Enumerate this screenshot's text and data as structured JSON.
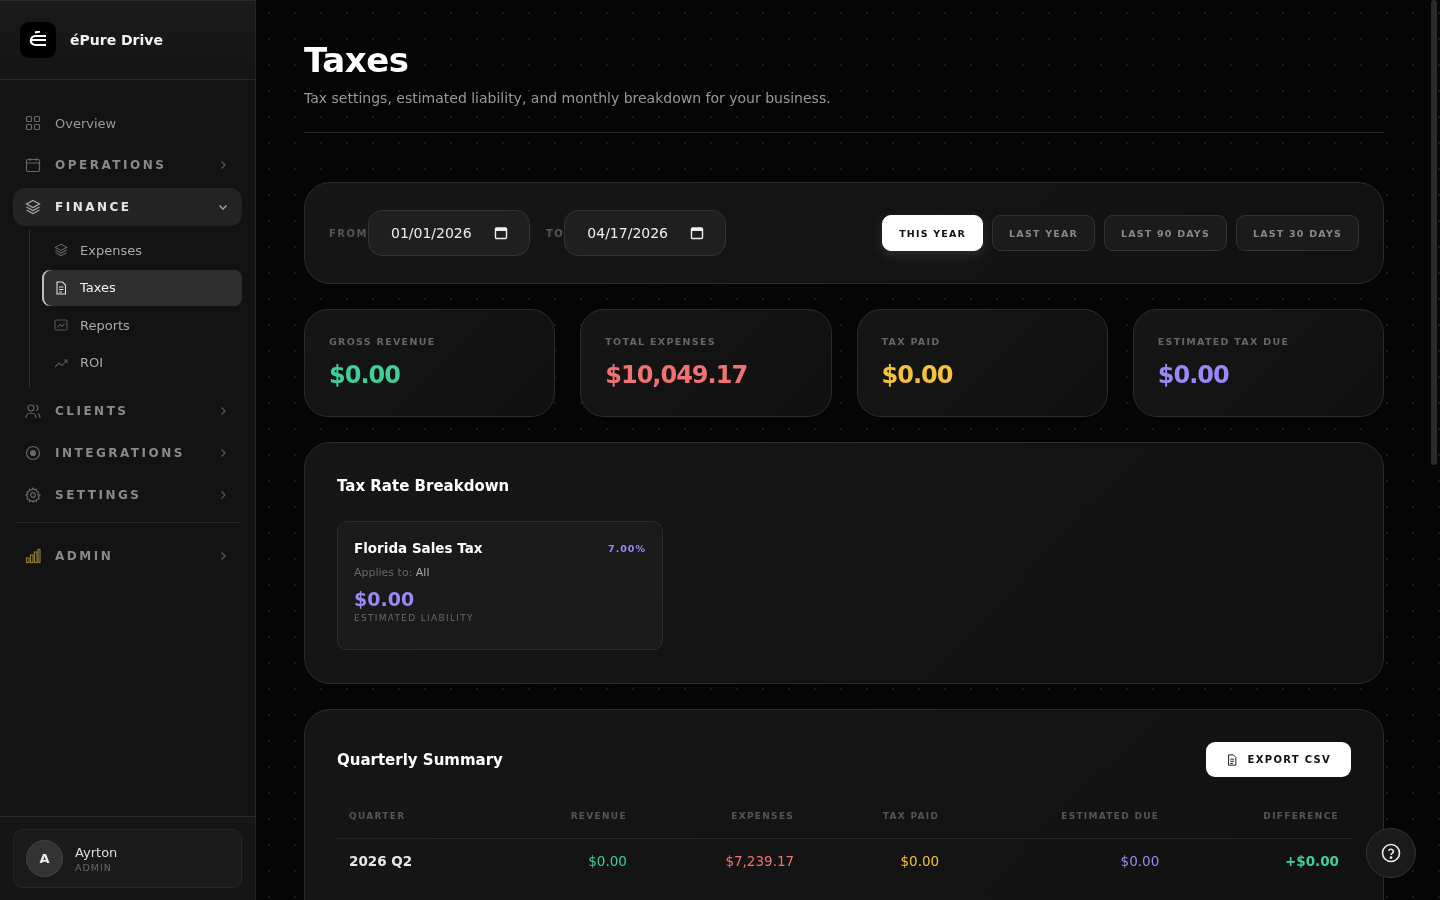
{
  "brand": {
    "name": "éPure Drive"
  },
  "nav": [
    {
      "label": "Overview",
      "kind": "link"
    },
    {
      "label": "OPERATIONS",
      "kind": "section",
      "expanded": false
    },
    {
      "label": "FINANCE",
      "kind": "section",
      "expanded": true,
      "children": [
        {
          "label": "Expenses",
          "selected": false
        },
        {
          "label": "Taxes",
          "selected": true
        },
        {
          "label": "Reports",
          "selected": false
        },
        {
          "label": "ROI",
          "selected": false
        }
      ]
    },
    {
      "label": "CLIENTS",
      "kind": "section",
      "expanded": false
    },
    {
      "label": "INTEGRATIONS",
      "kind": "section",
      "expanded": false
    },
    {
      "label": "SETTINGS",
      "kind": "section",
      "expanded": false
    },
    {
      "label": "ADMIN",
      "kind": "section",
      "expanded": false
    }
  ],
  "user": {
    "initial": "A",
    "name": "Ayrton",
    "role": "ADMIN"
  },
  "header": {
    "title": "Taxes",
    "subtitle": "Tax settings, estimated liability, and monthly breakdown for your business."
  },
  "filter": {
    "from_label": "FROM",
    "from_value": "01/01/2026",
    "to_label": "TO",
    "to_value": "04/17/2026",
    "presets": [
      {
        "label": "THIS YEAR",
        "selected": true
      },
      {
        "label": "LAST YEAR",
        "selected": false
      },
      {
        "label": "LAST 90 DAYS",
        "selected": false
      },
      {
        "label": "LAST 30 DAYS",
        "selected": false
      }
    ]
  },
  "stats": [
    {
      "label": "GROSS REVENUE",
      "value": "$0.00",
      "color": "#3ecf9a"
    },
    {
      "label": "TOTAL EXPENSES",
      "value": "$10,049.17",
      "color": "#f07272"
    },
    {
      "label": "TAX PAID",
      "value": "$0.00",
      "color": "#f5c33b"
    },
    {
      "label": "ESTIMATED TAX DUE",
      "value": "$0.00",
      "color": "#9b87f5"
    }
  ],
  "breakdown": {
    "title": "Tax Rate Breakdown",
    "rates": [
      {
        "name": "Florida Sales Tax",
        "rate": "7.00%",
        "applies_label": "Applies to:",
        "applies_value": "All",
        "amount": "$0.00",
        "amount_label": "ESTIMATED LIABILITY"
      }
    ]
  },
  "quarterly": {
    "title": "Quarterly Summary",
    "export_label": "EXPORT CSV",
    "columns": [
      {
        "label": "QUARTER",
        "color": "#e8e8e8"
      },
      {
        "label": "REVENUE",
        "color": "#3ecf9a"
      },
      {
        "label": "EXPENSES",
        "color": "#f07272"
      },
      {
        "label": "TAX PAID",
        "color": "#f5c33b"
      },
      {
        "label": "ESTIMATED DUE",
        "color": "#9b87f5"
      },
      {
        "label": "DIFFERENCE",
        "color": "#3ecf9a"
      }
    ],
    "rows": [
      [
        "2026 Q2",
        "$0.00",
        "$7,239.17",
        "$0.00",
        "$0.00",
        "+$0.00"
      ]
    ]
  }
}
